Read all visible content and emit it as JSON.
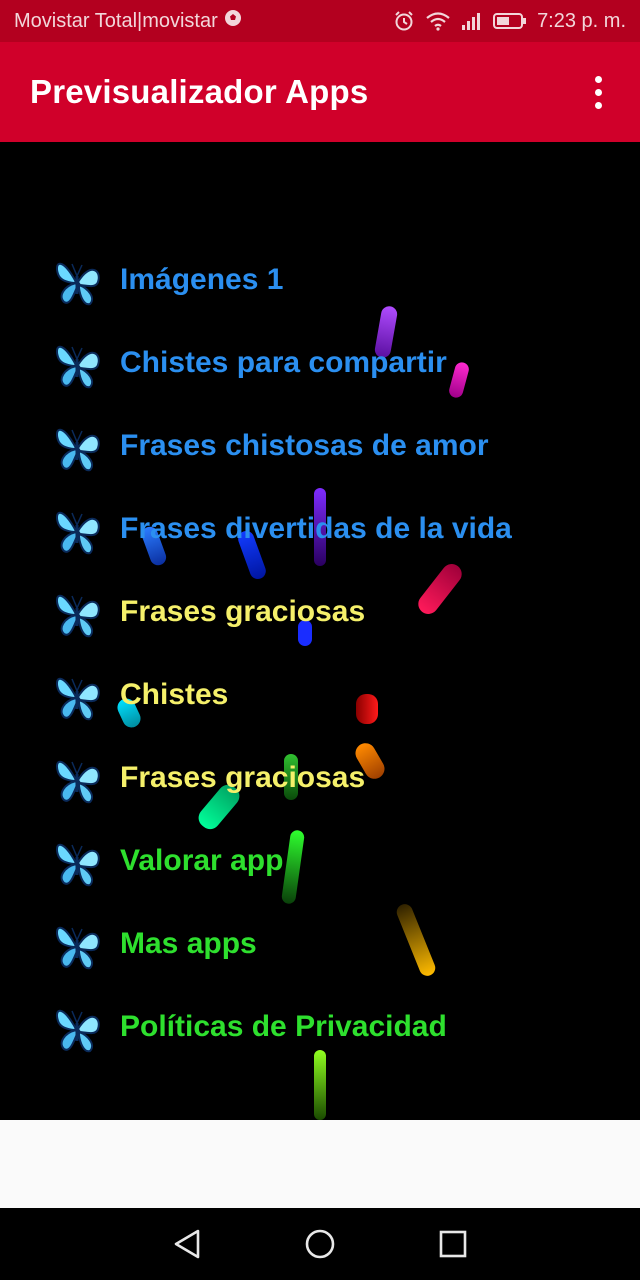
{
  "status_bar": {
    "carrier": "Movistar Total|movistar",
    "time": "7:23 p. m.",
    "icons": [
      "soccer-ball-icon",
      "alarm-icon",
      "wifi-icon",
      "signal-icon",
      "battery-icon"
    ]
  },
  "app_bar": {
    "title": "Previsualizador Apps",
    "overflow_icon": "more-vert-icon"
  },
  "menu": {
    "items": [
      {
        "label": "Imágenes 1",
        "color": "#2b8ff0"
      },
      {
        "label": "Chistes para compartir",
        "color": "#2b8ff0"
      },
      {
        "label": "Frases chistosas de amor",
        "color": "#2b8ff0"
      },
      {
        "label": "Frases divertidas de la vida",
        "color": "#2b8ff0"
      },
      {
        "label": "Frases graciosas",
        "color": "#f5f06a"
      },
      {
        "label": "Chistes",
        "color": "#f5f06a"
      },
      {
        "label": "Frases graciosas",
        "color": "#f5f06a"
      },
      {
        "label": "Valorar app",
        "color": "#2ee02e"
      },
      {
        "label": "Mas apps",
        "color": "#2ee02e"
      },
      {
        "label": "Políticas de Privacidad",
        "color": "#2ee02e"
      }
    ],
    "item_icon": "butterfly-icon"
  },
  "navigation": {
    "back_icon": "back-triangle-icon",
    "home_icon": "home-circle-icon",
    "recents_icon": "recents-square-icon"
  }
}
